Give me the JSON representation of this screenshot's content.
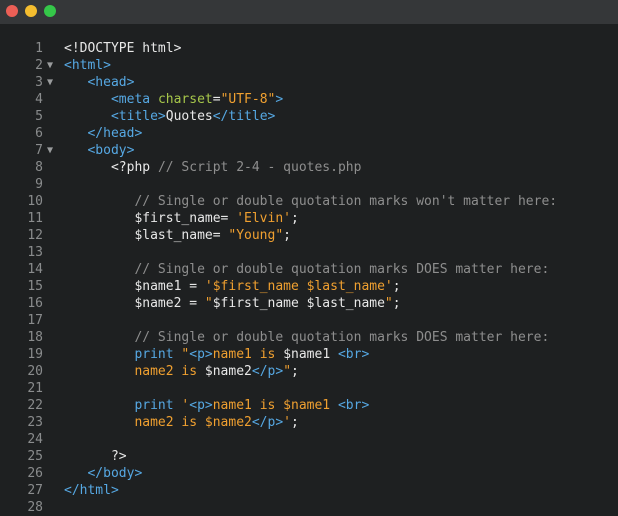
{
  "window": {
    "controls": [
      "close",
      "minimize",
      "maximize"
    ],
    "colors": {
      "close": "#ec5f56",
      "minimize": "#f4bd2f",
      "maximize": "#35c749",
      "background": "#1e2021",
      "tag": "#56a8e3",
      "attr": "#a6c64a",
      "string": "#f0a030",
      "comment": "#8e8e8e"
    }
  },
  "editor": {
    "lines": [
      {
        "n": "1",
        "fold": "",
        "indent": "",
        "parts": [
          {
            "t": "<!DOCTYPE html>",
            "c": "plain"
          }
        ]
      },
      {
        "n": "2",
        "fold": "▼",
        "indent": "",
        "parts": [
          {
            "t": "<html>",
            "c": "tag"
          }
        ]
      },
      {
        "n": "3",
        "fold": "▼",
        "indent": "   ",
        "parts": [
          {
            "t": "<head>",
            "c": "tag"
          }
        ]
      },
      {
        "n": "4",
        "fold": "",
        "indent": "      ",
        "parts": [
          {
            "t": "<meta ",
            "c": "tag"
          },
          {
            "t": "charset",
            "c": "attr"
          },
          {
            "t": "=",
            "c": "plain"
          },
          {
            "t": "\"UTF-8\"",
            "c": "str"
          },
          {
            "t": ">",
            "c": "tag"
          }
        ]
      },
      {
        "n": "5",
        "fold": "",
        "indent": "      ",
        "parts": [
          {
            "t": "<title>",
            "c": "tag"
          },
          {
            "t": "Quotes",
            "c": "plain"
          },
          {
            "t": "</title>",
            "c": "tag"
          }
        ]
      },
      {
        "n": "6",
        "fold": "",
        "indent": "   ",
        "parts": [
          {
            "t": "</head>",
            "c": "tag"
          }
        ]
      },
      {
        "n": "7",
        "fold": "▼",
        "indent": "   ",
        "parts": [
          {
            "t": "<body>",
            "c": "tag"
          }
        ]
      },
      {
        "n": "8",
        "fold": "",
        "indent": "      ",
        "parts": [
          {
            "t": "<?php ",
            "c": "plain"
          },
          {
            "t": "// Script 2-4 - quotes.php",
            "c": "cm"
          }
        ]
      },
      {
        "n": "9",
        "fold": "",
        "indent": "",
        "parts": []
      },
      {
        "n": "10",
        "fold": "",
        "indent": "         ",
        "parts": [
          {
            "t": "// Single or double quotation marks won't matter here:",
            "c": "cm"
          }
        ]
      },
      {
        "n": "11",
        "fold": "",
        "indent": "         ",
        "parts": [
          {
            "t": "$first_name= ",
            "c": "plain"
          },
          {
            "t": "'Elvin'",
            "c": "str"
          },
          {
            "t": ";",
            "c": "plain"
          }
        ]
      },
      {
        "n": "12",
        "fold": "",
        "indent": "         ",
        "parts": [
          {
            "t": "$last_name= ",
            "c": "plain"
          },
          {
            "t": "\"Young\"",
            "c": "str"
          },
          {
            "t": ";",
            "c": "plain"
          }
        ]
      },
      {
        "n": "13",
        "fold": "",
        "indent": "",
        "parts": []
      },
      {
        "n": "14",
        "fold": "",
        "indent": "         ",
        "parts": [
          {
            "t": "// Single or double quotation marks DOES matter here:",
            "c": "cm"
          }
        ]
      },
      {
        "n": "15",
        "fold": "",
        "indent": "         ",
        "parts": [
          {
            "t": "$name1 = ",
            "c": "plain"
          },
          {
            "t": "'$first_name $last_name'",
            "c": "str"
          },
          {
            "t": ";",
            "c": "plain"
          }
        ]
      },
      {
        "n": "16",
        "fold": "",
        "indent": "         ",
        "parts": [
          {
            "t": "$name2 = ",
            "c": "plain"
          },
          {
            "t": "\"",
            "c": "str"
          },
          {
            "t": "$first_name $last_name",
            "c": "plain"
          },
          {
            "t": "\"",
            "c": "str"
          },
          {
            "t": ";",
            "c": "plain"
          }
        ]
      },
      {
        "n": "17",
        "fold": "",
        "indent": "",
        "parts": []
      },
      {
        "n": "18",
        "fold": "",
        "indent": "         ",
        "parts": [
          {
            "t": "// Single or double quotation marks DOES matter here:",
            "c": "cm"
          }
        ]
      },
      {
        "n": "19",
        "fold": "",
        "indent": "         ",
        "parts": [
          {
            "t": "print ",
            "c": "tag"
          },
          {
            "t": "\"",
            "c": "str"
          },
          {
            "t": "<p>",
            "c": "tag"
          },
          {
            "t": "name1 is ",
            "c": "str"
          },
          {
            "t": "$name1 ",
            "c": "plain"
          },
          {
            "t": "<br>",
            "c": "tag"
          }
        ]
      },
      {
        "n": "20",
        "fold": "",
        "indent": "         ",
        "parts": [
          {
            "t": "name2 is ",
            "c": "str"
          },
          {
            "t": "$name2",
            "c": "plain"
          },
          {
            "t": "</p>",
            "c": "tag"
          },
          {
            "t": "\"",
            "c": "str"
          },
          {
            "t": ";",
            "c": "plain"
          }
        ]
      },
      {
        "n": "21",
        "fold": "",
        "indent": "",
        "parts": []
      },
      {
        "n": "22",
        "fold": "",
        "indent": "         ",
        "parts": [
          {
            "t": "print ",
            "c": "tag"
          },
          {
            "t": "'",
            "c": "str"
          },
          {
            "t": "<p>",
            "c": "tag"
          },
          {
            "t": "name1 is $name1 ",
            "c": "str"
          },
          {
            "t": "<br>",
            "c": "tag"
          }
        ]
      },
      {
        "n": "23",
        "fold": "",
        "indent": "         ",
        "parts": [
          {
            "t": "name2 is $name2",
            "c": "str"
          },
          {
            "t": "</p>",
            "c": "tag"
          },
          {
            "t": "'",
            "c": "str"
          },
          {
            "t": ";",
            "c": "plain"
          }
        ]
      },
      {
        "n": "24",
        "fold": "",
        "indent": "",
        "parts": []
      },
      {
        "n": "25",
        "fold": "",
        "indent": "      ",
        "parts": [
          {
            "t": "?>",
            "c": "plain"
          }
        ]
      },
      {
        "n": "26",
        "fold": "",
        "indent": "   ",
        "parts": [
          {
            "t": "</body>",
            "c": "tag"
          }
        ]
      },
      {
        "n": "27",
        "fold": "",
        "indent": "",
        "parts": [
          {
            "t": "</html>",
            "c": "tag"
          }
        ]
      },
      {
        "n": "28",
        "fold": "",
        "indent": "",
        "parts": []
      }
    ]
  }
}
